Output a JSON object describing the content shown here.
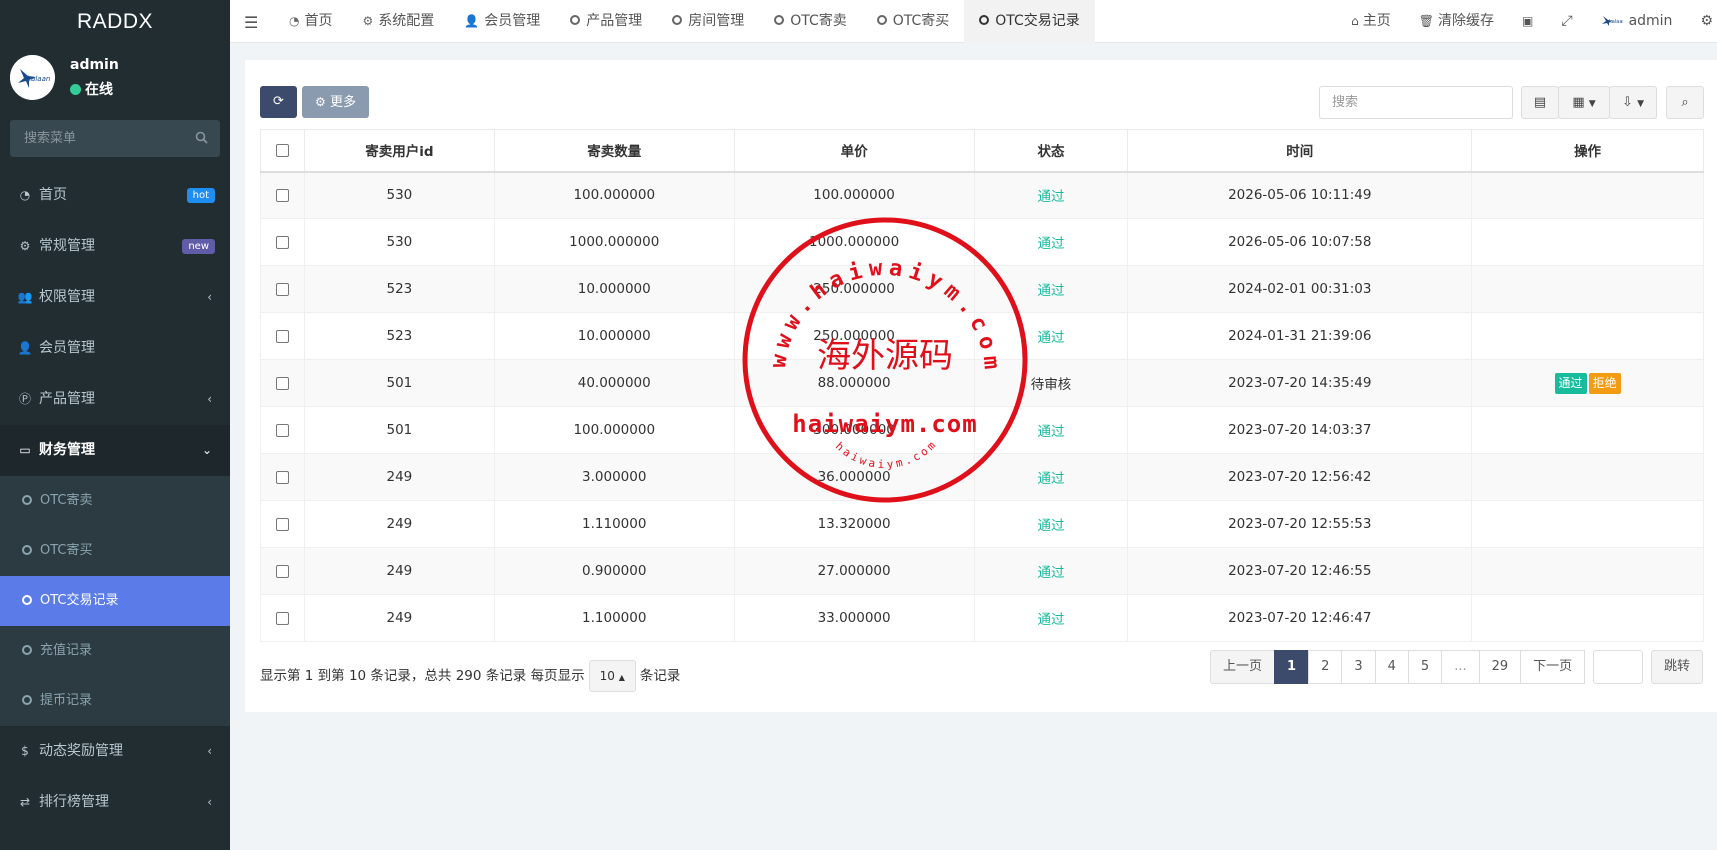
{
  "app": {
    "logo": "RADDX"
  },
  "user": {
    "name": "admin",
    "status": "在线",
    "avatar_text": "kalaan"
  },
  "sidebar": {
    "search_placeholder": "搜索菜单",
    "items": [
      {
        "label": "首页",
        "icon": "dashboard-icon",
        "badge": "hot"
      },
      {
        "label": "常规管理",
        "icon": "cogs-icon",
        "badge": "new"
      },
      {
        "label": "权限管理",
        "icon": "group-icon",
        "chevron": "‹"
      },
      {
        "label": "会员管理",
        "icon": "user-icon"
      },
      {
        "label": "产品管理",
        "icon": "product-p-icon",
        "chevron": "‹"
      },
      {
        "label": "财务管理",
        "icon": "credit-card-icon",
        "chevron": "⌄"
      }
    ],
    "subitems": [
      {
        "label": "OTC寄卖"
      },
      {
        "label": "OTC寄买"
      },
      {
        "label": "OTC交易记录"
      },
      {
        "label": "充值记录"
      },
      {
        "label": "提币记录"
      }
    ],
    "bottom_items": [
      {
        "label": "动态奖励管理",
        "icon": "money-bag-icon",
        "chevron": "‹"
      },
      {
        "label": "排行榜管理",
        "icon": "random-icon",
        "chevron": "‹"
      }
    ]
  },
  "topbar": {
    "tabs": [
      {
        "label": "首页",
        "icon": "dashboard-icon"
      },
      {
        "label": "系统配置",
        "icon": "gear-icon"
      },
      {
        "label": "会员管理",
        "icon": "user-icon"
      },
      {
        "label": "产品管理"
      },
      {
        "label": "房间管理"
      },
      {
        "label": "OTC寄卖"
      },
      {
        "label": "OTC寄买"
      },
      {
        "label": "OTC交易记录"
      }
    ],
    "right": {
      "home": "主页",
      "clear_cache": "清除缓存",
      "user": "admin"
    }
  },
  "toolbar": {
    "more_label": "更多",
    "search_placeholder": "搜索"
  },
  "table": {
    "columns": [
      "寄卖用户id",
      "寄卖数量",
      "单价",
      "状态",
      "时间",
      "操作"
    ],
    "rows": [
      {
        "uid": "530",
        "qty": "100.000000",
        "price": "100.000000",
        "status": "通过",
        "time": "2026-05-06 10:11:49"
      },
      {
        "uid": "530",
        "qty": "1000.000000",
        "price": "1000.000000",
        "status": "通过",
        "time": "2026-05-06 10:07:58"
      },
      {
        "uid": "523",
        "qty": "10.000000",
        "price": "250.000000",
        "status": "通过",
        "time": "2024-02-01 00:31:03"
      },
      {
        "uid": "523",
        "qty": "10.000000",
        "price": "250.000000",
        "status": "通过",
        "time": "2024-01-31 21:39:06"
      },
      {
        "uid": "501",
        "qty": "40.000000",
        "price": "88.000000",
        "status": "待审核",
        "time": "2023-07-20 14:35:49",
        "actions": [
          "通过",
          "拒绝"
        ]
      },
      {
        "uid": "501",
        "qty": "100.000000",
        "price": "300.000000",
        "status": "通过",
        "time": "2023-07-20 14:03:37"
      },
      {
        "uid": "249",
        "qty": "3.000000",
        "price": "36.000000",
        "status": "通过",
        "time": "2023-07-20 12:56:42"
      },
      {
        "uid": "249",
        "qty": "1.110000",
        "price": "13.320000",
        "status": "通过",
        "time": "2023-07-20 12:55:53"
      },
      {
        "uid": "249",
        "qty": "0.900000",
        "price": "27.000000",
        "status": "通过",
        "time": "2023-07-20 12:46:55"
      },
      {
        "uid": "249",
        "qty": "1.100000",
        "price": "33.000000",
        "status": "通过",
        "time": "2023-07-20 12:46:47"
      }
    ]
  },
  "footer": {
    "info_prefix": "显示第 1 到第 10 条记录，总共 290 条记录 每页显示",
    "page_size": "10",
    "info_suffix": "条记录",
    "pager": [
      "上一页",
      "1",
      "2",
      "3",
      "4",
      "5",
      "...",
      "29",
      "下一页"
    ],
    "jump_label": "跳转"
  },
  "watermark": {
    "top_arc": "www.haiwaiym.com",
    "center_cn": "海外源码",
    "main": "haiwaiym.com",
    "bottom_arc": "haiwaiym.com"
  },
  "colors": {
    "sidebar_bg": "#222d32",
    "active_sub": "#5b7ce8",
    "status_ok": "#18bc9c",
    "primary": "#3c4b6b",
    "reject": "#f39c12",
    "watermark": "#e0101a"
  }
}
